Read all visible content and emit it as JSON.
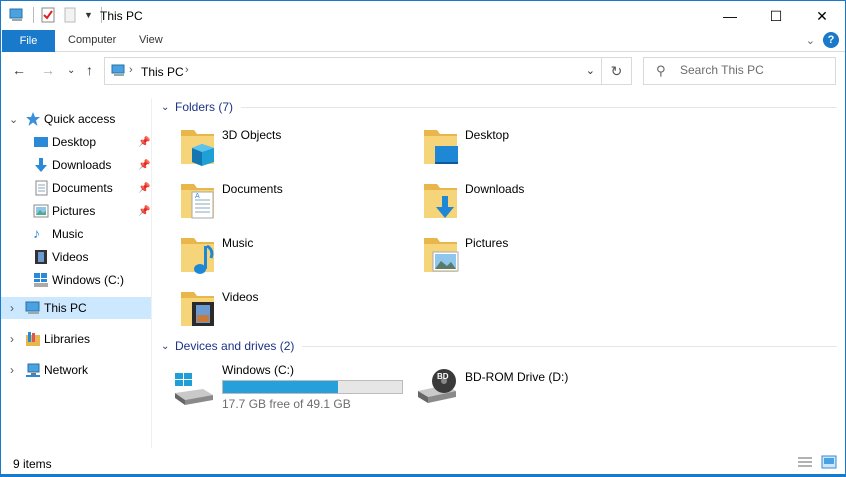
{
  "window": {
    "title": "This PC"
  },
  "ribbon": {
    "tabs": [
      "File",
      "Computer",
      "View"
    ]
  },
  "address": {
    "crumb": "This PC"
  },
  "search": {
    "placeholder": "Search This PC"
  },
  "nav": {
    "quick_access": "Quick access",
    "quick_items": [
      {
        "label": "Desktop",
        "pinned": true
      },
      {
        "label": "Downloads",
        "pinned": true
      },
      {
        "label": "Documents",
        "pinned": true
      },
      {
        "label": "Pictures",
        "pinned": true
      },
      {
        "label": "Music",
        "pinned": false
      },
      {
        "label": "Videos",
        "pinned": false
      },
      {
        "label": "Windows (C:)",
        "pinned": false
      }
    ],
    "this_pc": "This PC",
    "libraries": "Libraries",
    "network": "Network"
  },
  "content": {
    "folders_header": "Folders (7)",
    "folders": [
      "3D Objects",
      "Desktop",
      "Documents",
      "Downloads",
      "Music",
      "Pictures",
      "Videos"
    ],
    "drives_header": "Devices and drives (2)",
    "drives": [
      {
        "name": "Windows (C:)",
        "free_text": "17.7 GB free of 49.1 GB",
        "used_fraction": 0.64
      },
      {
        "name": "BD-ROM Drive (D:)"
      }
    ]
  },
  "status": {
    "items": "9 items"
  },
  "colors": {
    "accent": "#1979ca",
    "selection": "#cce8ff",
    "header_text": "#1e3287",
    "bar_fill": "#26a0da"
  }
}
